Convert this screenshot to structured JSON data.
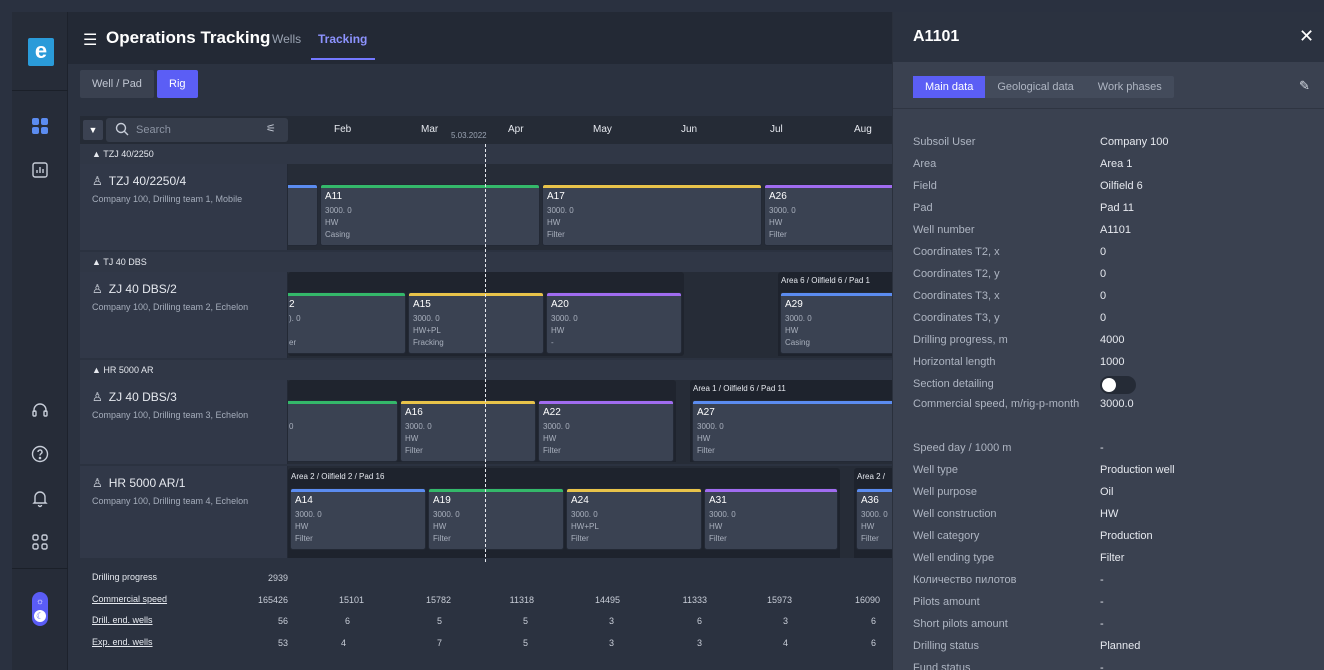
{
  "nav": {
    "logo_letter": "e"
  },
  "header": {
    "title": "Operations Tracking",
    "tabs": [
      "Wells",
      "Tracking"
    ]
  },
  "toolbar": {
    "segments": [
      "Well / Pad",
      "Rig"
    ]
  },
  "gantt": {
    "search_placeholder": "Search",
    "months": [
      "Feb",
      "Mar",
      "Apr",
      "May",
      "Jun",
      "Jul",
      "Aug"
    ],
    "today_label": "5.03.2022",
    "groups": [
      "TZJ 40/2250",
      "TJ 40 DBS",
      "HR 5000 AR"
    ],
    "rows": [
      {
        "name": "TZJ 40/2250/4",
        "sub": "Company 100, Drilling team 1, Mobile"
      },
      {
        "name": "ZJ 40 DBS/2",
        "sub": "Company 100, Drilling team 2, Echelon"
      },
      {
        "name": "ZJ 40 DBS/3",
        "sub": "Company 100, Drilling team 3, Echelon"
      },
      {
        "name": "HR 5000 AR/1",
        "sub": "Company 100, Drilling team 4, Echelon"
      }
    ],
    "context_labels": [
      "Area 6 / Oilfield 6 / Pad 1",
      "Area 1 / Oilfield 6 / Pad 11",
      "Area 2 / Oilfield 2 / Pad 16",
      "Area 2 /"
    ],
    "bars": [
      {
        "name": "A11",
        "l1": "3000. 0",
        "l2": "HW",
        "l3": "Casing"
      },
      {
        "name": "A17",
        "l1": "3000. 0",
        "l2": "HW",
        "l3": "Filter"
      },
      {
        "name": "A26",
        "l1": "3000. 0",
        "l2": "HW",
        "l3": "Filter"
      },
      {
        "name": "2",
        "l1": "). 0",
        "l2": "",
        "l3": "er"
      },
      {
        "name": "A15",
        "l1": "3000. 0",
        "l2": "HW+PL",
        "l3": "Fracking"
      },
      {
        "name": "A20",
        "l1": "3000. 0",
        "l2": "HW",
        "l3": "-"
      },
      {
        "name": "A29",
        "l1": "3000. 0",
        "l2": "HW",
        "l3": "Casing"
      },
      {
        "name": "",
        "l1": "0",
        "l2": "",
        "l3": ""
      },
      {
        "name": "A16",
        "l1": "3000. 0",
        "l2": "HW",
        "l3": "Filter"
      },
      {
        "name": "A22",
        "l1": "3000. 0",
        "l2": "HW",
        "l3": "Filter"
      },
      {
        "name": "A27",
        "l1": "3000. 0",
        "l2": "HW",
        "l3": "Filter"
      },
      {
        "name": "A14",
        "l1": "3000. 0",
        "l2": "HW",
        "l3": "Filter"
      },
      {
        "name": "A19",
        "l1": "3000. 0",
        "l2": "HW",
        "l3": "Filter"
      },
      {
        "name": "A24",
        "l1": "3000. 0",
        "l2": "HW+PL",
        "l3": "Filter"
      },
      {
        "name": "A31",
        "l1": "3000. 0",
        "l2": "HW",
        "l3": "Filter"
      },
      {
        "name": "A36",
        "l1": "3000. 0",
        "l2": "HW",
        "l3": "Filter"
      }
    ],
    "stats": [
      {
        "label": "Drilling progress",
        "total": "2939",
        "values": [
          "",
          "",
          "",
          "",
          "",
          "",
          ""
        ]
      },
      {
        "label": "Commercial speed",
        "total": "165426",
        "values": [
          "15101",
          "15782",
          "11318",
          "14495",
          "11333",
          "15973",
          "16090"
        ]
      },
      {
        "label": "Drill. end. wells",
        "total": "56",
        "values": [
          "6",
          "5",
          "5",
          "3",
          "6",
          "3",
          "6"
        ]
      },
      {
        "label": "Exp. end. wells",
        "total": "53",
        "values": [
          "4",
          "7",
          "5",
          "3",
          "3",
          "4",
          "6"
        ]
      }
    ],
    "colors": {
      "blue": "#5b8cf0",
      "green": "#34b86a",
      "yellow": "#e8c34a",
      "purple": "#a06cf0"
    }
  },
  "panel": {
    "title": "A1101",
    "tabs": [
      "Main data",
      "Geological data",
      "Work phases"
    ],
    "fields": [
      {
        "k": "Subsoil User",
        "v": "Company 100"
      },
      {
        "k": "Area",
        "v": "Area 1"
      },
      {
        "k": "Field",
        "v": "Oilfield 6"
      },
      {
        "k": "Pad",
        "v": "Pad 11"
      },
      {
        "k": "Well number",
        "v": "A1101"
      },
      {
        "k": "Coordinates T2, x",
        "v": "0"
      },
      {
        "k": "Coordinates  T2, y",
        "v": "0"
      },
      {
        "k": "Coordinates  T3, x",
        "v": "0"
      },
      {
        "k": "Coordinates  T3, y",
        "v": "0"
      },
      {
        "k": "Drilling progress, m",
        "v": "4000"
      },
      {
        "k": "Horizontal length",
        "v": "1000"
      },
      {
        "k": "Section detailing",
        "v": ""
      },
      {
        "k": "Commercial speed, m/rig-p-month",
        "v": "3000.0"
      },
      {
        "k": "Speed day / 1000 m",
        "v": "-"
      },
      {
        "k": "Well type",
        "v": "Production well"
      },
      {
        "k": "Well purpose",
        "v": "Oil"
      },
      {
        "k": "Well construction",
        "v": "HW"
      },
      {
        "k": "Well category",
        "v": "Production"
      },
      {
        "k": "Well ending type",
        "v": "Filter"
      },
      {
        "k": "Количество пилотов",
        "v": "-"
      },
      {
        "k": "Pilots amount",
        "v": "-"
      },
      {
        "k": "Short pilots amount",
        "v": "-"
      },
      {
        "k": "Drilling status",
        "v": "Planned"
      },
      {
        "k": "Fund status",
        "v": "-"
      }
    ]
  }
}
